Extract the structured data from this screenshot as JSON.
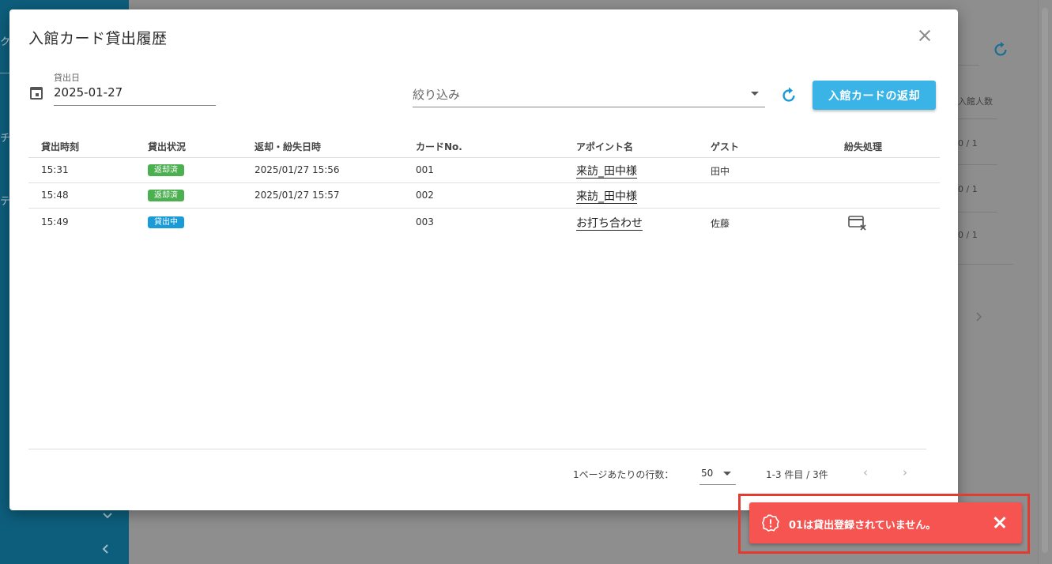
{
  "modal": {
    "title": "入館カード貸出履歴",
    "date_label": "貸出日",
    "date_value": "2025-01-27",
    "filter_placeholder": "絞り込み",
    "return_button": "入館カードの返却"
  },
  "table": {
    "headers": [
      "貸出時刻",
      "貸出状況",
      "返却・紛失日時",
      "カードNo.",
      "アポイント名",
      "ゲスト",
      "紛失処理"
    ],
    "rows": [
      {
        "time": "15:31",
        "status": "返却済",
        "returned": "2025/01/27 15:56",
        "card": "001",
        "appointment": "来訪_田中様",
        "guest": "田中"
      },
      {
        "time": "15:48",
        "status": "返却済",
        "returned": "2025/01/27 15:57",
        "card": "002",
        "appointment": "来訪_田中様",
        "guest": ""
      },
      {
        "time": "15:49",
        "status": "貸出中",
        "returned": "",
        "card": "003",
        "appointment": "お打ち合わせ",
        "guest": "佐藤"
      }
    ]
  },
  "pagination": {
    "rows_per_page_label": "1ページあたりの行数：",
    "rows_per_page": "50",
    "range": "1-3 件目 / 3件",
    "prev": "‹",
    "next": "›"
  },
  "background": {
    "header_visible": "入館人数",
    "counts": [
      "0 / 1",
      "0 / 1",
      "0 / 1"
    ],
    "side_glyphs": [
      "ク",
      "チ",
      "テ"
    ]
  },
  "snackbar": {
    "message": "01は貸出登録されていません。"
  },
  "colors": {
    "primary": "#3ab4e6",
    "returned_badge": "#4caf50",
    "lending_badge": "#1a9bd7",
    "error": "#f55451",
    "sidebar": "#0d5e7c"
  }
}
